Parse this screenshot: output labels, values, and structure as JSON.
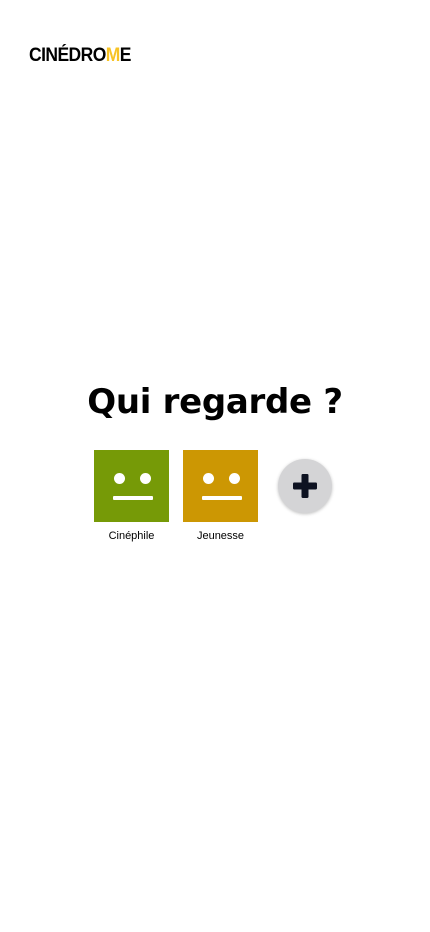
{
  "brand": {
    "logo_main": "CINÉDRO",
    "logo_accent": "M",
    "logo_tail": "E",
    "accent_color": "#f7c325"
  },
  "title": "Qui regarde ?",
  "profiles": [
    {
      "name": "Cinéphile",
      "color": "#769a07",
      "icon": "neutral-face-icon"
    },
    {
      "name": "Jeunesse",
      "color": "#cc9703",
      "icon": "neutral-face-icon"
    }
  ],
  "add_profile": {
    "icon": "plus-icon",
    "button_color": "#d4d4d6",
    "icon_color": "#0d1221"
  }
}
